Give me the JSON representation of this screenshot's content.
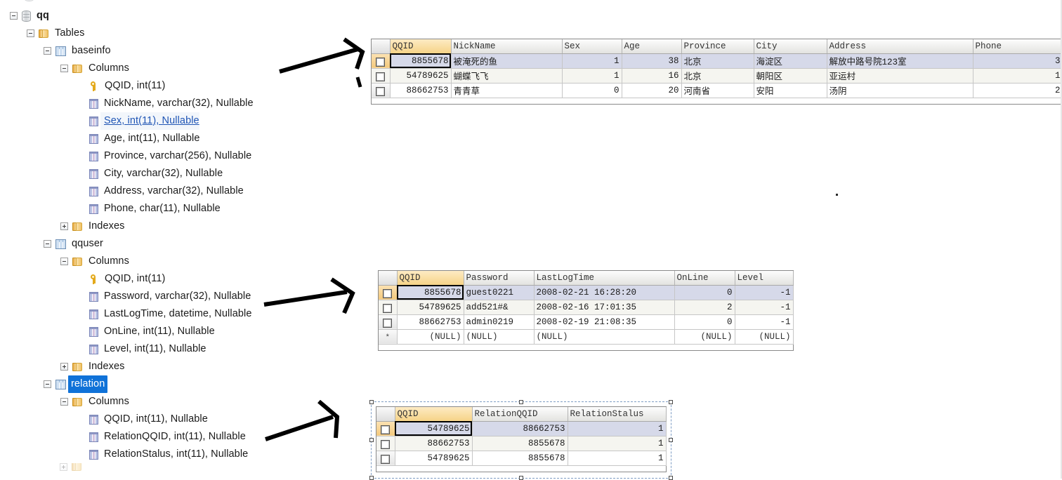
{
  "tree": {
    "root": {
      "label": "qq",
      "icon": "database-icon",
      "expanded": true
    },
    "tables_folder": {
      "label": "Tables",
      "icon": "folder-icon",
      "expanded": true
    },
    "nodes": [
      {
        "label": "baseinfo",
        "icon": "table-icon",
        "expanded": true,
        "indent": 3,
        "type": "table"
      },
      {
        "label": "Columns",
        "icon": "folder-icon",
        "expanded": true,
        "indent": 4,
        "type": "folder"
      },
      {
        "label": "QQID, int(11)",
        "icon": "key-icon",
        "indent": 5,
        "type": "pk-column"
      },
      {
        "label": "NickName, varchar(32), Nullable",
        "icon": "column-icon",
        "indent": 5,
        "type": "column"
      },
      {
        "label": "Sex, int(11), Nullable",
        "icon": "column-icon",
        "indent": 5,
        "type": "column",
        "style": "link"
      },
      {
        "label": "Age, int(11), Nullable",
        "icon": "column-icon",
        "indent": 5,
        "type": "column"
      },
      {
        "label": "Province, varchar(256), Nullable",
        "icon": "column-icon",
        "indent": 5,
        "type": "column"
      },
      {
        "label": "City, varchar(32), Nullable",
        "icon": "column-icon",
        "indent": 5,
        "type": "column"
      },
      {
        "label": "Address, varchar(32), Nullable",
        "icon": "column-icon",
        "indent": 5,
        "type": "column"
      },
      {
        "label": "Phone, char(11), Nullable",
        "icon": "column-icon",
        "indent": 5,
        "type": "column"
      },
      {
        "label": "Indexes",
        "icon": "folder-icon",
        "expanded": false,
        "indent": 4,
        "type": "folder"
      },
      {
        "label": "qquser",
        "icon": "table-icon",
        "expanded": true,
        "indent": 3,
        "type": "table"
      },
      {
        "label": "Columns",
        "icon": "folder-icon",
        "expanded": true,
        "indent": 4,
        "type": "folder"
      },
      {
        "label": "QQID, int(11)",
        "icon": "key-icon",
        "indent": 5,
        "type": "pk-column"
      },
      {
        "label": "Password, varchar(32), Nullable",
        "icon": "column-icon",
        "indent": 5,
        "type": "column"
      },
      {
        "label": "LastLogTime, datetime, Nullable",
        "icon": "column-icon",
        "indent": 5,
        "type": "column"
      },
      {
        "label": "OnLine, int(11), Nullable",
        "icon": "column-icon",
        "indent": 5,
        "type": "column"
      },
      {
        "label": "Level, int(11), Nullable",
        "icon": "column-icon",
        "indent": 5,
        "type": "column"
      },
      {
        "label": "Indexes",
        "icon": "folder-icon",
        "expanded": false,
        "indent": 4,
        "type": "folder"
      },
      {
        "label": "relation",
        "icon": "table-icon",
        "expanded": true,
        "indent": 3,
        "type": "table",
        "style": "selected"
      },
      {
        "label": "Columns",
        "icon": "folder-icon",
        "expanded": true,
        "indent": 4,
        "type": "folder"
      },
      {
        "label": "QQID, int(11), Nullable",
        "icon": "column-icon",
        "indent": 5,
        "type": "column"
      },
      {
        "label": "RelationQQID, int(11), Nullable",
        "icon": "column-icon",
        "indent": 5,
        "type": "column"
      },
      {
        "label": "RelationStalus, int(11), Nullable",
        "icon": "column-icon",
        "indent": 5,
        "type": "column"
      }
    ]
  },
  "grid_baseinfo": {
    "name": "baseinfo",
    "columns": [
      "QQID",
      "NickName",
      "Sex",
      "Age",
      "Province",
      "City",
      "Address",
      "Phone"
    ],
    "key_column": "QQID",
    "rows": [
      {
        "QQID": "8855678",
        "NickName": "被淹死的鱼",
        "Sex": "1",
        "Age": "38",
        "Province": "北京",
        "City": "海淀区",
        "Address": "解放中路号院123室",
        "Phone": "3"
      },
      {
        "QQID": "54789625",
        "NickName": "蝴蝶飞飞",
        "Sex": "1",
        "Age": "16",
        "Province": "北京",
        "City": "朝阳区",
        "Address": "亚运村",
        "Phone": "1"
      },
      {
        "QQID": "88662753",
        "NickName": "青青草",
        "Sex": "0",
        "Age": "20",
        "Province": "河南省",
        "City": "安阳",
        "Address": "汤阴",
        "Phone": "2"
      }
    ],
    "selected_row": 0,
    "selected_cell_column": "QQID"
  },
  "grid_qquser": {
    "name": "qquser",
    "columns": [
      "QQID",
      "Password",
      "LastLogTime",
      "OnLine",
      "Level"
    ],
    "key_column": "QQID",
    "rows": [
      {
        "QQID": "8855678",
        "Password": "guest0221",
        "LastLogTime": "2008-02-21 16:28:20",
        "OnLine": "0",
        "Level": "-1"
      },
      {
        "QQID": "54789625",
        "Password": "add521#&",
        "LastLogTime": "2008-02-16 17:01:35",
        "OnLine": "2",
        "Level": "-1"
      },
      {
        "QQID": "88662753",
        "Password": "admin0219",
        "LastLogTime": "2008-02-19 21:08:35",
        "OnLine": "0",
        "Level": "-1"
      }
    ],
    "new_row": {
      "marker": "*",
      "QQID": "(NULL)",
      "Password": "(NULL)",
      "LastLogTime": "(NULL)",
      "OnLine": "(NULL)",
      "Level": "(NULL)"
    },
    "selected_row": 0,
    "selected_cell_column": "QQID"
  },
  "grid_relation": {
    "name": "relation",
    "columns": [
      "QQID",
      "RelationQQID",
      "RelationStalus"
    ],
    "key_column": "QQID",
    "rows": [
      {
        "QQID": "54789625",
        "RelationQQID": "88662753",
        "RelationStalus": "1"
      },
      {
        "QQID": "88662753",
        "RelationQQID": "8855678",
        "RelationStalus": "1"
      },
      {
        "QQID": "54789625",
        "RelationQQID": "8855678",
        "RelationStalus": "1"
      }
    ],
    "selected_row": 0,
    "selected_cell_column": "QQID",
    "selected_object": true
  },
  "annotations": {
    "arrows": [
      {
        "name": "arrow-to-baseinfo-grid",
        "points_to": "grid_baseinfo"
      },
      {
        "name": "arrow-to-qquser-grid",
        "points_to": "grid_qquser"
      },
      {
        "name": "arrow-to-relation-grid",
        "points_to": "grid_relation"
      }
    ]
  },
  "colors": {
    "key_header": "#f6d387",
    "selection_blue": "#1072d8",
    "selected_row": "#d6d9e9",
    "link": "#1f55b5"
  }
}
